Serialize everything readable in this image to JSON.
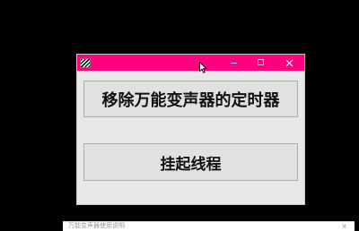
{
  "window": {
    "titlebar_color": "#ff0080",
    "app_icon": "striped-app-icon",
    "controls": {
      "minimize": "minimize-icon",
      "maximize": "maximize-icon",
      "close": "close-icon"
    }
  },
  "buttons": {
    "remove_label": "移除万能变声器的定时器",
    "suspend_label": "挂起线程"
  },
  "taskbar": {
    "text": "万能变声器使用说明",
    "close_glyph": "×"
  }
}
